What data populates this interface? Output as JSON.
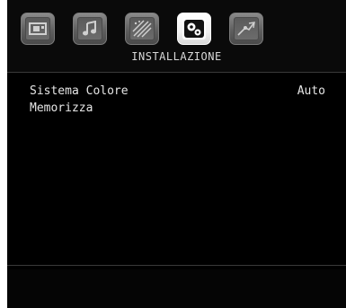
{
  "header": {
    "title": "INSTALLAZIONE",
    "tabs": [
      {
        "icon": "picture-icon",
        "active": false
      },
      {
        "icon": "sound-icon",
        "active": false
      },
      {
        "icon": "settings-icon",
        "active": false
      },
      {
        "icon": "installation-icon",
        "active": true
      },
      {
        "icon": "source-icon",
        "active": false
      }
    ]
  },
  "menu": {
    "items": [
      {
        "label": "Sistema Colore",
        "value": "Auto"
      },
      {
        "label": "Memorizza",
        "value": ""
      }
    ]
  },
  "colors": {
    "background": "#000000",
    "text": "#e6e6e6",
    "tab_active": "#ffffff",
    "tab_inactive": "#6a6a6a"
  }
}
